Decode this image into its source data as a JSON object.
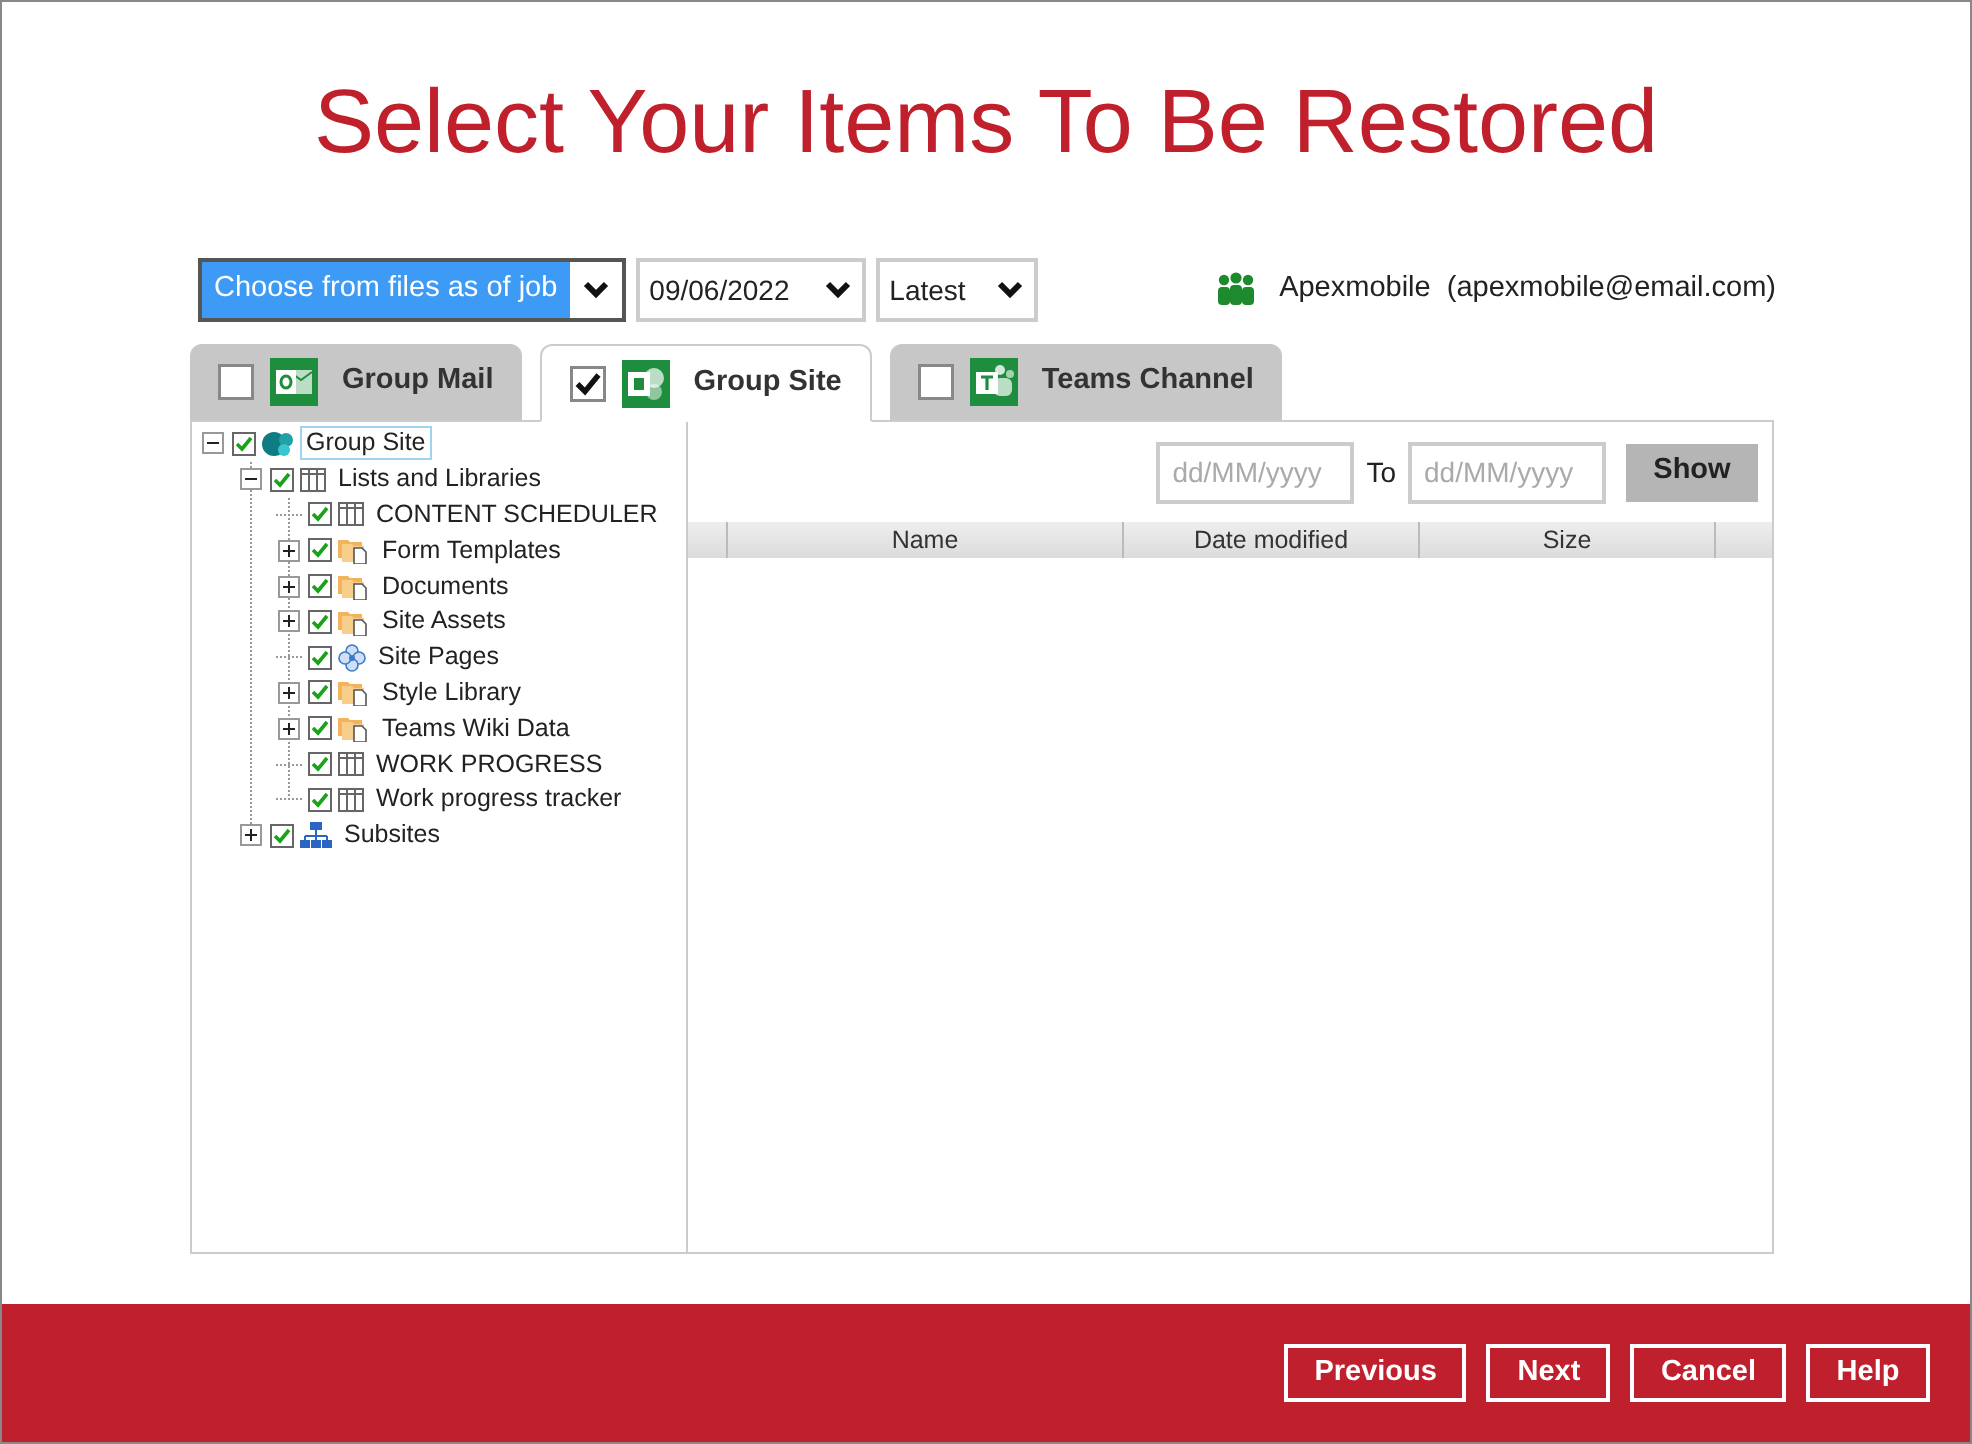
{
  "title": "Select Your Items To Be Restored",
  "filters": {
    "mode": "Choose from files as of job",
    "date": "09/06/2022",
    "version": "Latest"
  },
  "account": "Apexmobile  (apexmobile@email.com)",
  "tabs": [
    {
      "label": "Group Mail",
      "kind": "mail",
      "checked": false,
      "selected": false
    },
    {
      "label": "Group Site",
      "kind": "site",
      "checked": true,
      "selected": true
    },
    {
      "label": "Teams Channel",
      "kind": "teams",
      "checked": false,
      "selected": false
    }
  ],
  "tree": [
    {
      "label": "Group Site",
      "kind": "site",
      "checked": true,
      "expanded": true,
      "selected": true,
      "children": [
        {
          "label": "Lists and Libraries",
          "kind": "list",
          "checked": true,
          "expanded": true,
          "selected": false,
          "children": [
            {
              "label": "CONTENT SCHEDULER",
              "kind": "list",
              "checked": true,
              "selected": false
            },
            {
              "label": "Form Templates",
              "kind": "library",
              "checked": true,
              "expanded": false,
              "selected": false
            },
            {
              "label": "Documents",
              "kind": "library",
              "checked": true,
              "expanded": false,
              "selected": false
            },
            {
              "label": "Site Assets",
              "kind": "library",
              "checked": true,
              "expanded": false,
              "selected": false
            },
            {
              "label": "Site Pages",
              "kind": "pages",
              "checked": true,
              "selected": false
            },
            {
              "label": "Style Library",
              "kind": "library",
              "checked": true,
              "expanded": false,
              "selected": false
            },
            {
              "label": "Teams Wiki Data",
              "kind": "library",
              "checked": true,
              "expanded": false,
              "selected": false
            },
            {
              "label": "WORK PROGRESS",
              "kind": "list",
              "checked": true,
              "selected": false
            },
            {
              "label": "Work progress tracker",
              "kind": "list",
              "checked": true,
              "selected": false
            }
          ]
        },
        {
          "label": "Subsites",
          "kind": "subsites",
          "checked": true,
          "expanded": false,
          "selected": false
        }
      ]
    }
  ],
  "date_range": {
    "from_placeholder": "dd/MM/yyyy",
    "to_label": "To",
    "to_placeholder": "dd/MM/yyyy",
    "button": "Show"
  },
  "columns": [
    "Name",
    "Date modified",
    "Size"
  ],
  "buttons": [
    "Previous",
    "Next",
    "Cancel",
    "Help"
  ]
}
